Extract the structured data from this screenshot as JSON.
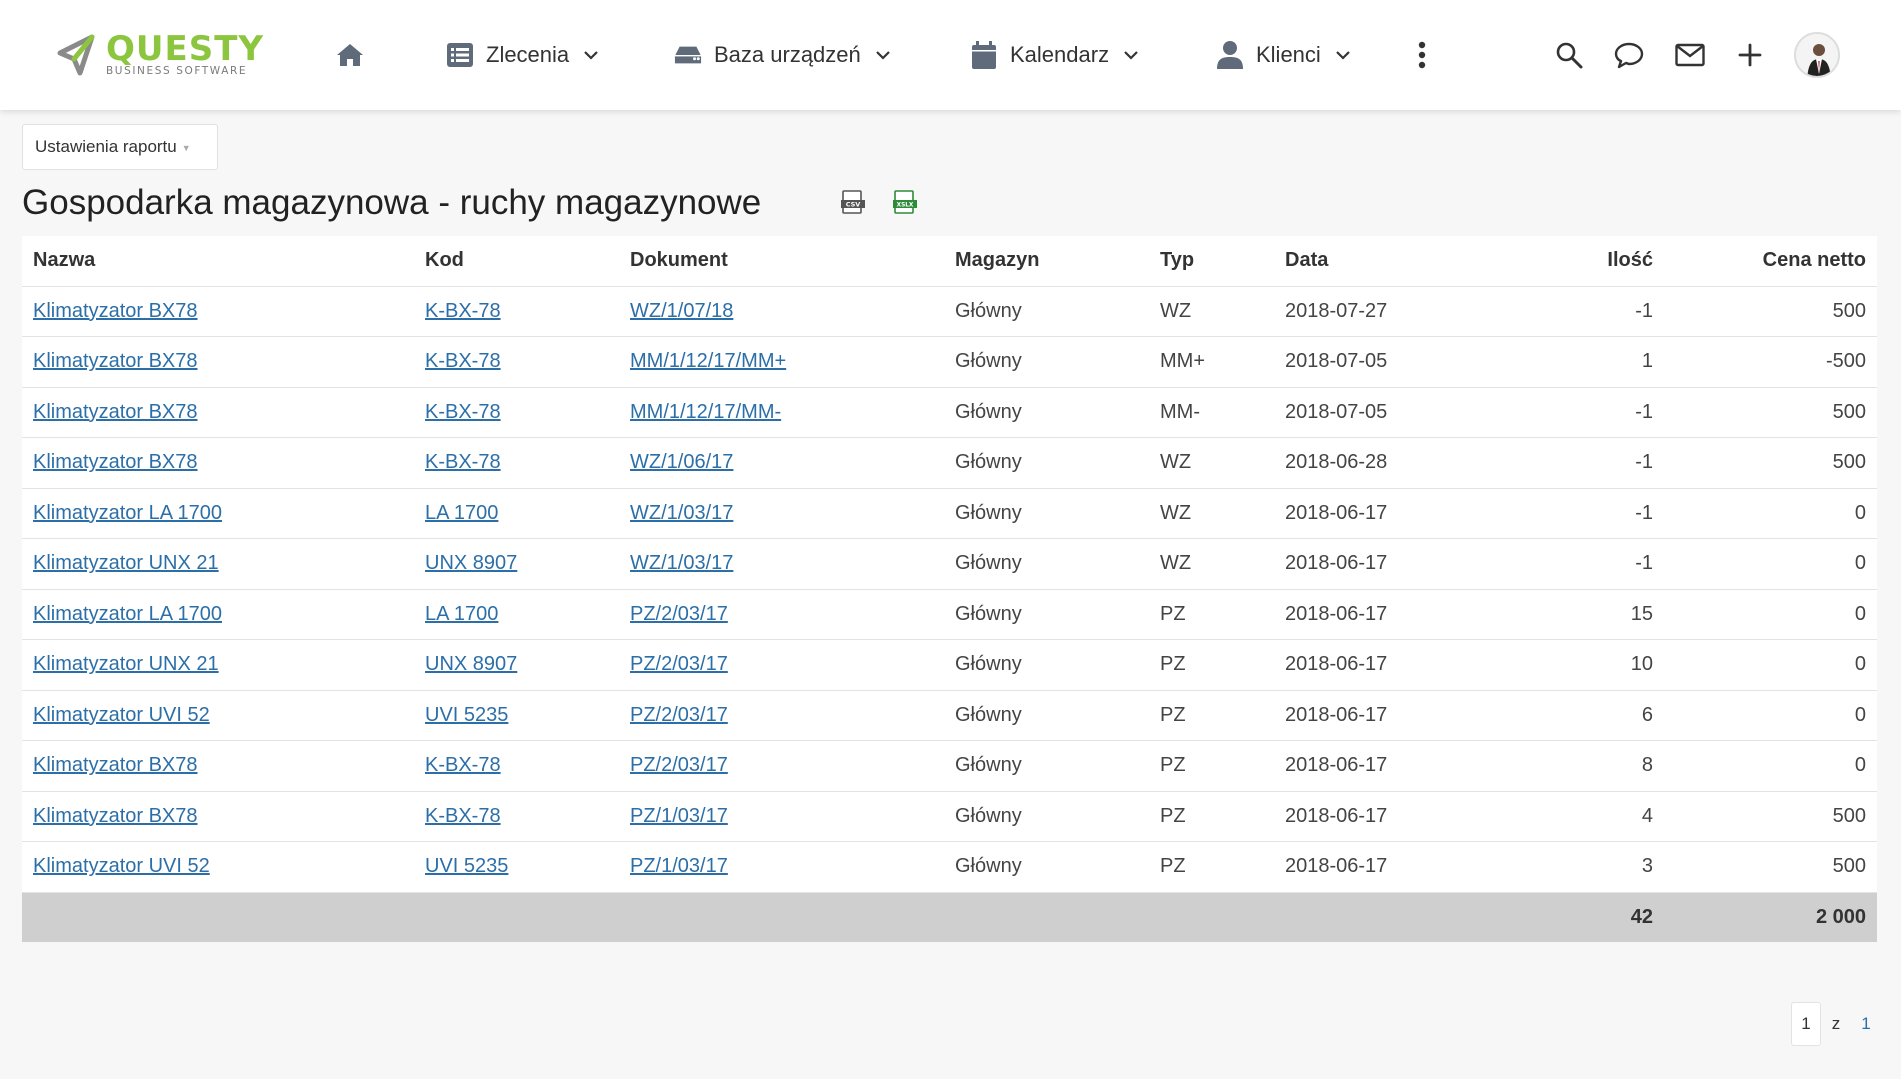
{
  "brand": {
    "name": "QUESTY",
    "tagline": "BUSINESS SOFTWARE",
    "accent_color": "#8cc63e"
  },
  "nav": {
    "home_icon": "home-icon",
    "items": [
      {
        "label": "Zlecenia",
        "icon": "list-icon"
      },
      {
        "label": "Baza urządzeń",
        "icon": "device-icon"
      },
      {
        "label": "Kalendarz",
        "icon": "calendar-icon"
      },
      {
        "label": "Klienci",
        "icon": "user-icon"
      }
    ],
    "more_icon": "more-vertical-icon",
    "tools": [
      "search-icon",
      "chat-icon",
      "mail-icon",
      "plus-icon"
    ]
  },
  "report": {
    "settings_label": "Ustawienia raportu",
    "title": "Gospodarka magazynowa - ruchy magazynowe",
    "export": {
      "csv": "CSV",
      "xlsx": "XSLX"
    },
    "columns": [
      "Nazwa",
      "Kod",
      "Dokument",
      "Magazyn",
      "Typ",
      "Data",
      "Ilość",
      "Cena netto"
    ],
    "rows": [
      {
        "nazwa": "Klimatyzator BX78",
        "kod": "K-BX-78",
        "dokument": "WZ/1/07/18",
        "magazyn": "Główny",
        "typ": "WZ",
        "data": "2018-07-27",
        "ilosc": "-1",
        "cena": "500"
      },
      {
        "nazwa": "Klimatyzator BX78",
        "kod": "K-BX-78",
        "dokument": "MM/1/12/17/MM+",
        "magazyn": "Główny",
        "typ": "MM+",
        "data": "2018-07-05",
        "ilosc": "1",
        "cena": "-500"
      },
      {
        "nazwa": "Klimatyzator BX78",
        "kod": "K-BX-78",
        "dokument": "MM/1/12/17/MM-",
        "magazyn": "Główny",
        "typ": "MM-",
        "data": "2018-07-05",
        "ilosc": "-1",
        "cena": "500"
      },
      {
        "nazwa": "Klimatyzator BX78",
        "kod": "K-BX-78",
        "dokument": "WZ/1/06/17",
        "magazyn": "Główny",
        "typ": "WZ",
        "data": "2018-06-28",
        "ilosc": "-1",
        "cena": "500"
      },
      {
        "nazwa": "Klimatyzator LA 1700",
        "kod": "LA 1700",
        "dokument": "WZ/1/03/17",
        "magazyn": "Główny",
        "typ": "WZ",
        "data": "2018-06-17",
        "ilosc": "-1",
        "cena": "0"
      },
      {
        "nazwa": "Klimatyzator UNX 21",
        "kod": "UNX 8907",
        "dokument": "WZ/1/03/17",
        "magazyn": "Główny",
        "typ": "WZ",
        "data": "2018-06-17",
        "ilosc": "-1",
        "cena": "0"
      },
      {
        "nazwa": "Klimatyzator LA 1700",
        "kod": "LA 1700",
        "dokument": "PZ/2/03/17",
        "magazyn": "Główny",
        "typ": "PZ",
        "data": "2018-06-17",
        "ilosc": "15",
        "cena": "0"
      },
      {
        "nazwa": "Klimatyzator UNX 21",
        "kod": "UNX 8907",
        "dokument": "PZ/2/03/17",
        "magazyn": "Główny",
        "typ": "PZ",
        "data": "2018-06-17",
        "ilosc": "10",
        "cena": "0"
      },
      {
        "nazwa": "Klimatyzator UVI 52",
        "kod": "UVI 5235",
        "dokument": "PZ/2/03/17",
        "magazyn": "Główny",
        "typ": "PZ",
        "data": "2018-06-17",
        "ilosc": "6",
        "cena": "0"
      },
      {
        "nazwa": "Klimatyzator BX78",
        "kod": "K-BX-78",
        "dokument": "PZ/2/03/17",
        "magazyn": "Główny",
        "typ": "PZ",
        "data": "2018-06-17",
        "ilosc": "8",
        "cena": "0"
      },
      {
        "nazwa": "Klimatyzator BX78",
        "kod": "K-BX-78",
        "dokument": "PZ/1/03/17",
        "magazyn": "Główny",
        "typ": "PZ",
        "data": "2018-06-17",
        "ilosc": "4",
        "cena": "500"
      },
      {
        "nazwa": "Klimatyzator UVI 52",
        "kod": "UVI 5235",
        "dokument": "PZ/1/03/17",
        "magazyn": "Główny",
        "typ": "PZ",
        "data": "2018-06-17",
        "ilosc": "3",
        "cena": "500"
      }
    ],
    "totals": {
      "ilosc": "42",
      "cena": "2 000"
    }
  },
  "pager": {
    "current": "1",
    "of_label": "z",
    "total": "1"
  },
  "colors": {
    "link": "#2c6fa8",
    "total_row": "#cfcfcf",
    "page_bg": "#f7f7f7"
  }
}
